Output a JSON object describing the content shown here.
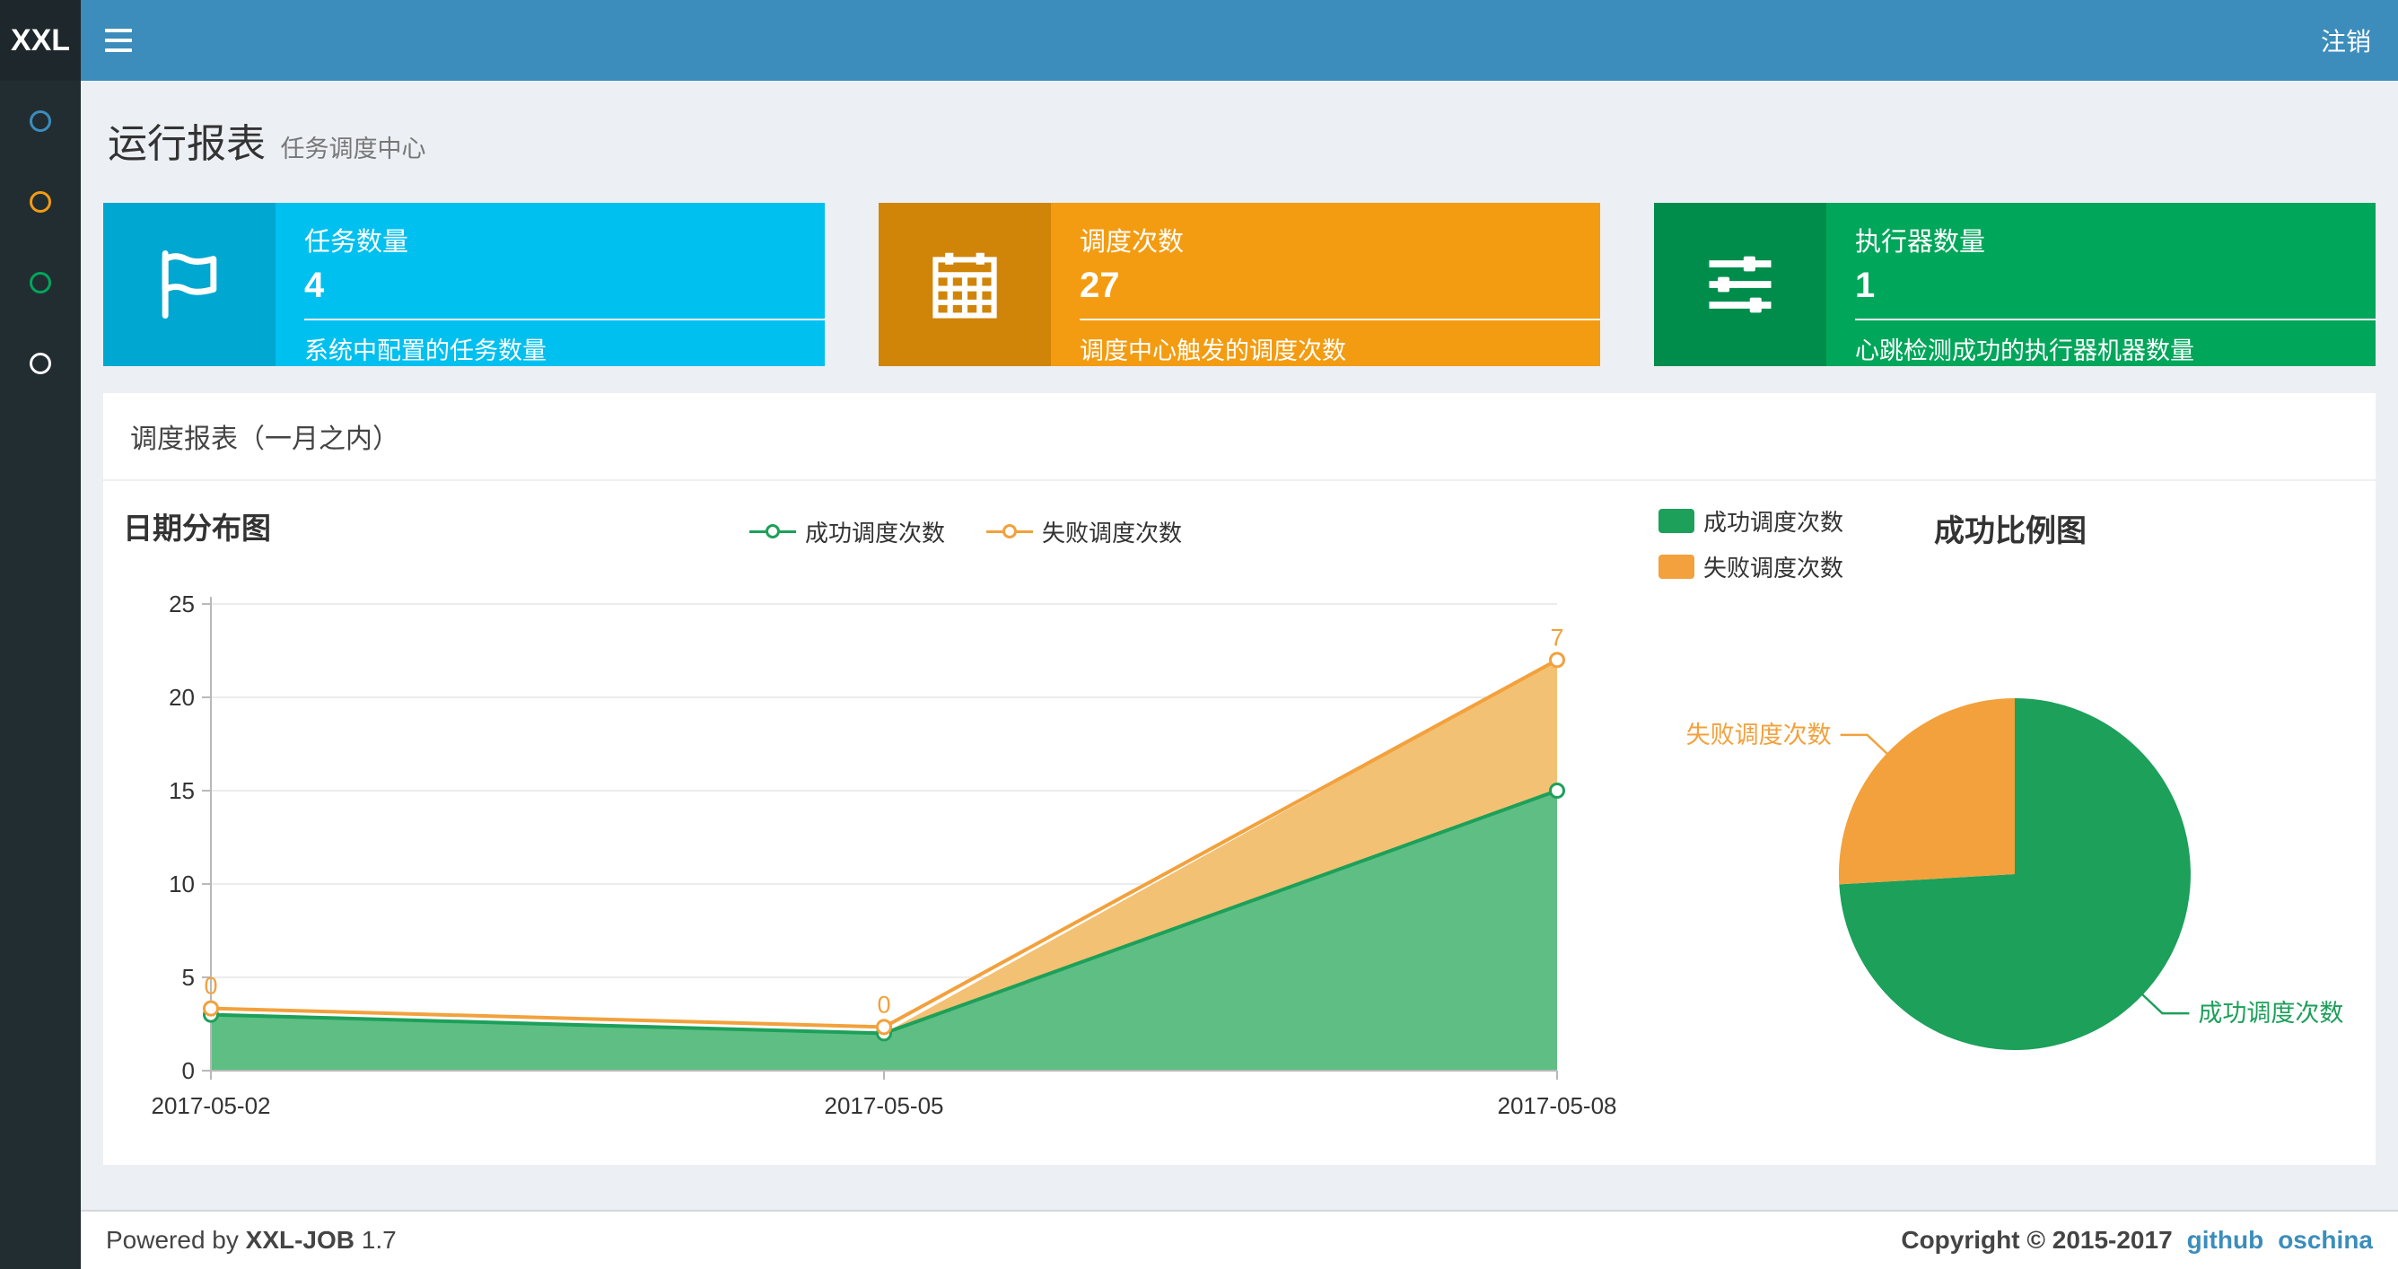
{
  "navbar": {
    "logo": "XXL",
    "logout": "注销"
  },
  "sidebar": {
    "items": [
      {
        "name": "dashboard",
        "color": "#3c8dbc"
      },
      {
        "name": "job-manage",
        "color": "#f39c12"
      },
      {
        "name": "job-log",
        "color": "#00a65a"
      },
      {
        "name": "executor-manage",
        "color": "#ffffff"
      }
    ]
  },
  "header": {
    "title": "运行报表",
    "subtitle": "任务调度中心"
  },
  "stats": [
    {
      "title": "任务数量",
      "value": "4",
      "desc": "系统中配置的任务数量",
      "color": "#00c0ef",
      "icon_bg": "#00a7d0",
      "icon": "flag-icon"
    },
    {
      "title": "调度次数",
      "value": "27",
      "desc": "调度中心触发的调度次数",
      "color": "#f39c12",
      "icon_bg": "#d08508",
      "icon": "calendar-icon"
    },
    {
      "title": "执行器数量",
      "value": "1",
      "desc": "心跳检测成功的执行器机器数量",
      "color": "#00a65a",
      "icon_bg": "#008d4c",
      "icon": "sliders-icon"
    }
  ],
  "panel": {
    "title": "调度报表（一月之内）"
  },
  "chart_data": [
    {
      "type": "area",
      "title": "日期分布图",
      "categories": [
        "2017-05-02",
        "2017-05-05",
        "2017-05-08"
      ],
      "series": [
        {
          "name": "成功调度次数",
          "values": [
            3,
            2,
            15
          ],
          "color": "#1ca05a",
          "fill": "#5fbe83"
        },
        {
          "name": "失败调度次数",
          "values": [
            0,
            0,
            7
          ],
          "color": "#f2a13c",
          "fill": "#f3c173"
        }
      ],
      "stacked": true,
      "xlabel": "",
      "ylabel": "",
      "ylim": [
        0,
        25
      ],
      "yticks": [
        0,
        5,
        10,
        15,
        20,
        25
      ],
      "point_labels": {
        "series": "失败调度次数",
        "values": [
          "0",
          "0",
          "7"
        ]
      },
      "legend_position": "top",
      "grid": true
    },
    {
      "type": "pie",
      "title": "成功比例图",
      "slices": [
        {
          "label": "成功调度次数",
          "value": 20,
          "color": "#1ca05a"
        },
        {
          "label": "失败调度次数",
          "value": 7,
          "color": "#f2a13c"
        }
      ],
      "legend_position": "top-left"
    }
  ],
  "footer": {
    "powered_prefix": "Powered by ",
    "app": "XXL-JOB",
    "version": " 1.7",
    "copyright": "Copyright © 2015-2017",
    "links": [
      {
        "label": "github"
      },
      {
        "label": "oschina"
      }
    ]
  }
}
